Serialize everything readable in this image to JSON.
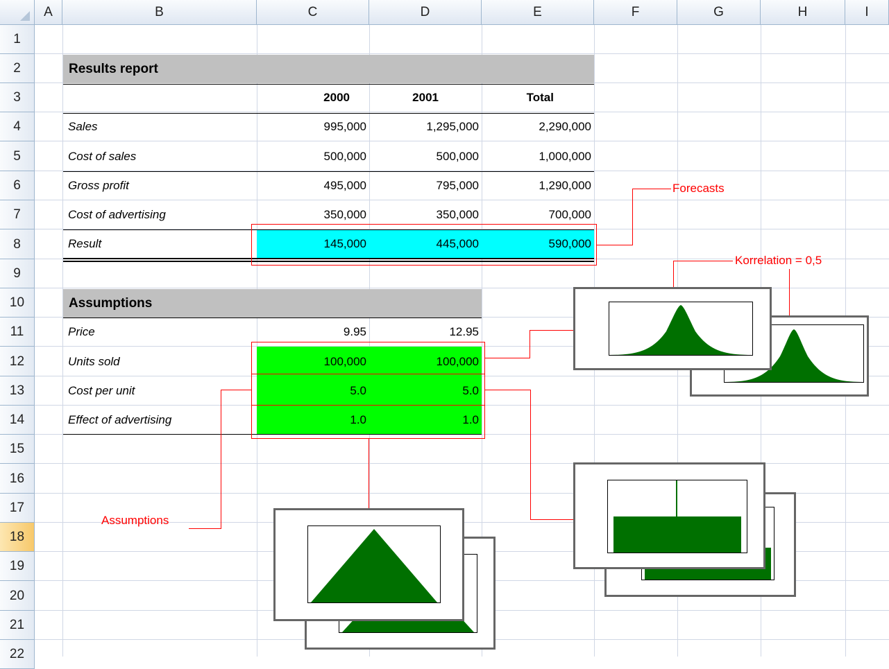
{
  "columns": [
    "A",
    "B",
    "C",
    "D",
    "E",
    "F",
    "G",
    "H",
    "I"
  ],
  "rows": [
    "1",
    "2",
    "3",
    "4",
    "5",
    "6",
    "7",
    "8",
    "9",
    "10",
    "11",
    "12",
    "13",
    "14",
    "15",
    "16",
    "17",
    "18",
    "19",
    "20",
    "21",
    "22"
  ],
  "results": {
    "title": "Results report",
    "headers": [
      "2000",
      "2001",
      "Total"
    ],
    "rows": [
      {
        "label": "Sales",
        "c": "995,000",
        "d": "1,295,000",
        "e": "2,290,000"
      },
      {
        "label": "Cost of sales",
        "c": "500,000",
        "d": "500,000",
        "e": "1,000,000"
      },
      {
        "label": "Gross profit",
        "c": "495,000",
        "d": "795,000",
        "e": "1,290,000"
      },
      {
        "label": "Cost of advertising",
        "c": "350,000",
        "d": "350,000",
        "e": "700,000"
      },
      {
        "label": "Result",
        "c": "145,000",
        "d": "445,000",
        "e": "590,000"
      }
    ]
  },
  "assumptions": {
    "title": "Assumptions",
    "rows": [
      {
        "label": "Price",
        "c": "9.95",
        "d": "12.95"
      },
      {
        "label": "Units sold",
        "c": "100,000",
        "d": "100,000"
      },
      {
        "label": "Cost per unit",
        "c": "5.0",
        "d": "5.0"
      },
      {
        "label": "Effect of advertising",
        "c": "1.0",
        "d": "1.0"
      }
    ]
  },
  "annotations": {
    "forecasts": "Forecasts",
    "correlation": "Korrelation = 0,5",
    "assumptions": "Assumptions"
  },
  "colors": {
    "result_fill": "#00ffff",
    "assumption_fill": "#00ff00",
    "annotation": "#ff0000",
    "chart_fill": "#007000",
    "header_band": "#c0c0c0"
  }
}
